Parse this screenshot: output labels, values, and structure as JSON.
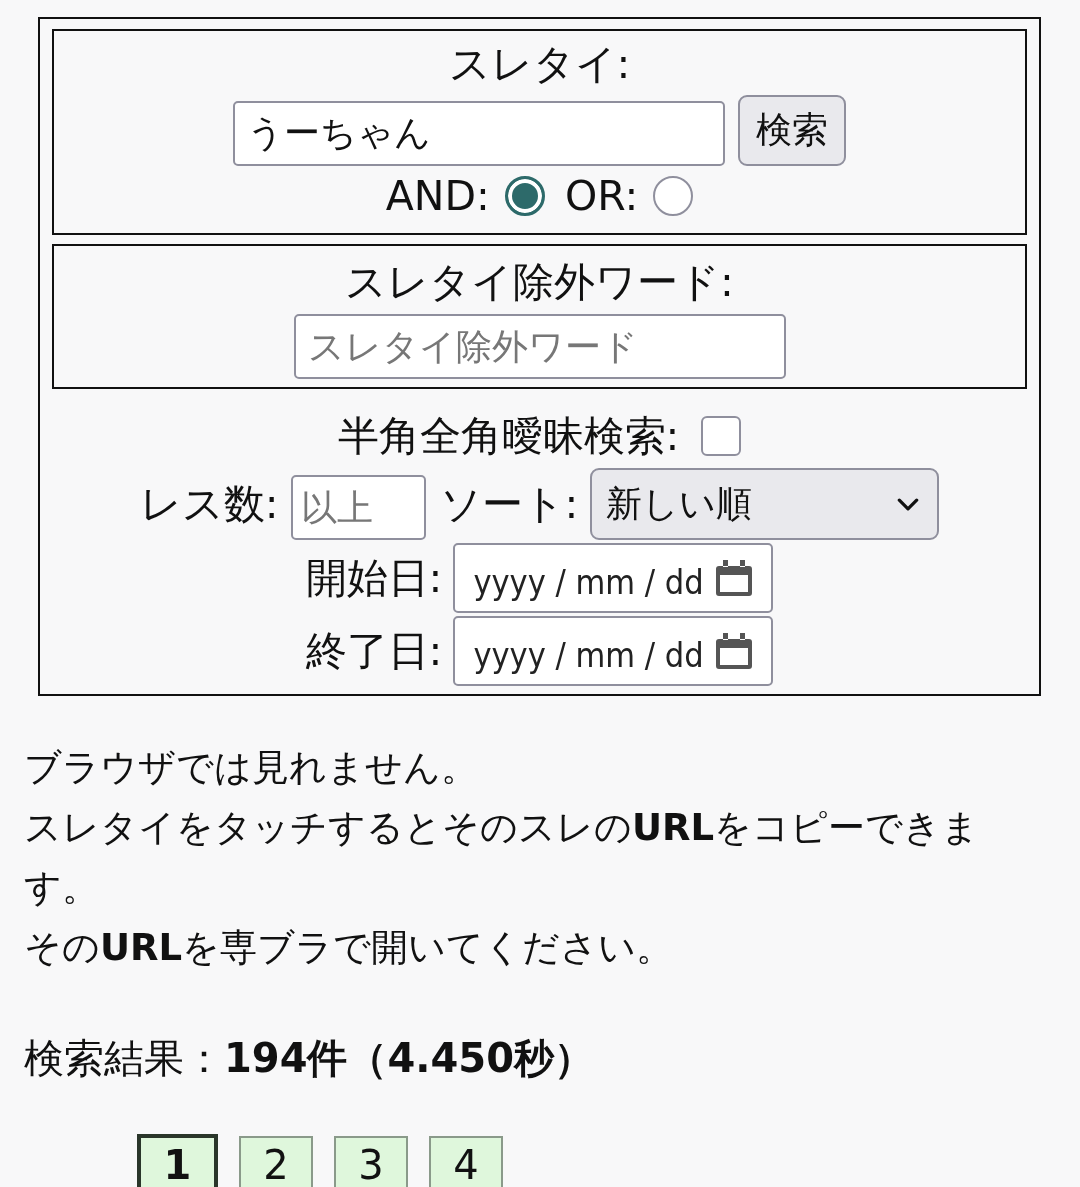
{
  "title_search": {
    "label": "スレタイ:",
    "value": "うーちゃん",
    "button": "検索",
    "modes": [
      {
        "label": "AND:",
        "selected": true
      },
      {
        "label": "OR:",
        "selected": false
      }
    ]
  },
  "exclude": {
    "label": "スレタイ除外ワード:",
    "placeholder": "スレタイ除外ワード"
  },
  "fuzzy": {
    "label": "半角全角曖昧検索:",
    "checked": false
  },
  "res_count": {
    "label": "レス数:",
    "placeholder": "以上"
  },
  "sort": {
    "label": "ソート:",
    "value": "新しい順"
  },
  "dates": [
    {
      "label": "開始日:",
      "placeholder": "yyyy / mm / dd"
    },
    {
      "label": "終了日:",
      "placeholder": "yyyy / mm / dd"
    }
  ],
  "notice": [
    "ブラウザでは見れません。",
    "スレタイをタッチするとそのスレの**URL**をコピーできます。",
    "その**URL**を専ブラで開いてください。"
  ],
  "result_heading": "検索結果：**194件（4.450秒）**",
  "pages": [
    {
      "label": "1",
      "selected": true
    },
    {
      "label": "2",
      "selected": false
    },
    {
      "label": "3",
      "selected": false
    },
    {
      "label": "4",
      "selected": false
    }
  ]
}
